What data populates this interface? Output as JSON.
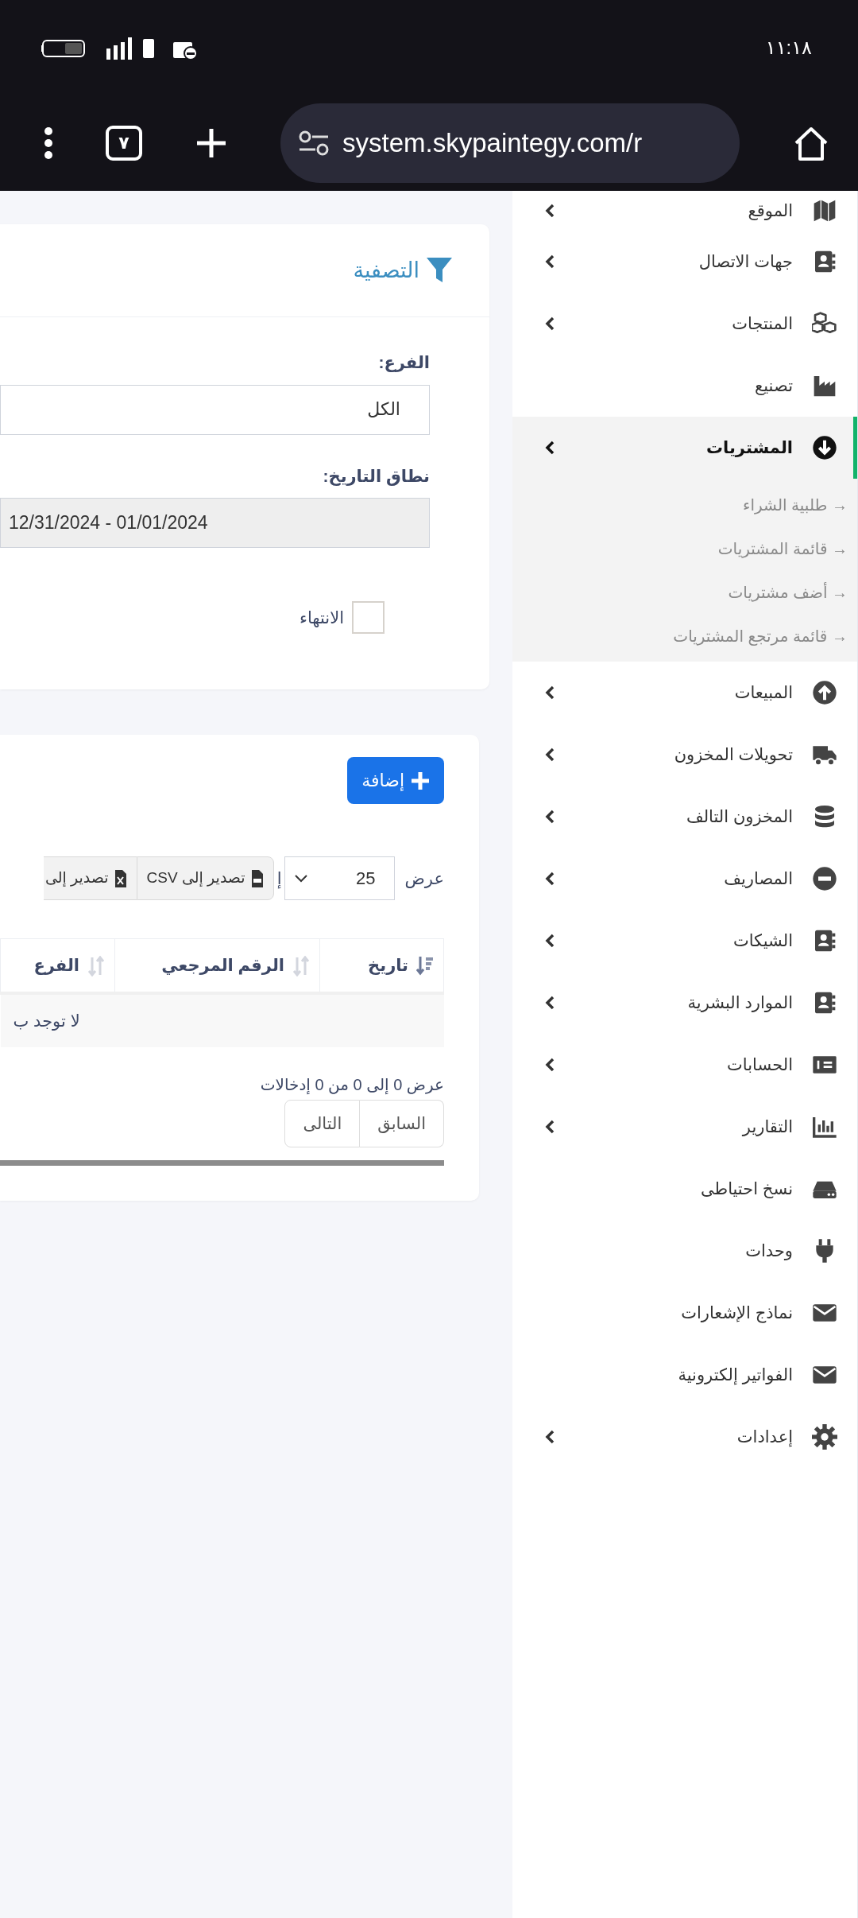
{
  "status_bar": {
    "time": "١١:١٨"
  },
  "browser": {
    "tab_count": "٧",
    "url": "system.skypaintegy.com/r"
  },
  "sidebar": {
    "items": [
      {
        "label": "الموقع",
        "has_submenu": true,
        "selected": false
      },
      {
        "label": "جهات الاتصال",
        "has_submenu": true,
        "selected": false
      },
      {
        "label": "المنتجات",
        "has_submenu": true,
        "selected": false
      },
      {
        "label": "تصنيع",
        "has_submenu": false,
        "selected": false
      },
      {
        "label": "المشتريات",
        "has_submenu": true,
        "selected": true,
        "children": [
          {
            "label": "→ طلبية الشراء"
          },
          {
            "label": "→ قائمة المشتريات"
          },
          {
            "label": "→ أضف مشتريات"
          },
          {
            "label": "→ قائمة مرتجع المشتريات"
          }
        ]
      },
      {
        "label": "المبيعات",
        "has_submenu": true,
        "selected": false
      },
      {
        "label": "تحويلات المخزون",
        "has_submenu": true,
        "selected": false
      },
      {
        "label": "المخزون التالف",
        "has_submenu": true,
        "selected": false
      },
      {
        "label": "المصاريف",
        "has_submenu": true,
        "selected": false
      },
      {
        "label": "الشيكات",
        "has_submenu": true,
        "selected": false
      },
      {
        "label": "الموارد البشرية",
        "has_submenu": true,
        "selected": false
      },
      {
        "label": "الحسابات",
        "has_submenu": true,
        "selected": false
      },
      {
        "label": "التقارير",
        "has_submenu": true,
        "selected": false
      },
      {
        "label": "نسخ احتياطى",
        "has_submenu": false,
        "selected": false
      },
      {
        "label": "وحدات",
        "has_submenu": false,
        "selected": false
      },
      {
        "label": "نماذج الإشعارات",
        "has_submenu": false,
        "selected": false
      },
      {
        "label": "الفواتير إلكترونية",
        "has_submenu": false,
        "selected": false
      },
      {
        "label": "إعدادات",
        "has_submenu": true,
        "selected": false
      }
    ]
  },
  "filter": {
    "title": "التصفية",
    "fields": [
      {
        "label": "الفرع:",
        "value": "الكل",
        "readonly": false
      },
      {
        "label": "نطاق التاريخ:",
        "value": "12/31/2024 - 01/01/2024",
        "readonly": true
      }
    ],
    "checkbox": {
      "label": "الانتهاء",
      "checked": false
    }
  },
  "list_panel": {
    "add_button": "إضافة",
    "length_label": "عرض",
    "length_value": "25",
    "length_suffix": "إ",
    "export_buttons": [
      "تصدير إلى CSV",
      "تصدير إلى"
    ],
    "columns": [
      {
        "label": "تاريخ",
        "sorted": true
      },
      {
        "label": "الرقم المرجعي",
        "sorted": false
      },
      {
        "label": "الفرع",
        "sorted": false
      }
    ],
    "empty_text": "لا توجد ب",
    "info": "عرض 0 إلى 0 من 0 إدخالات",
    "pagination": [
      "السابق",
      "التالى"
    ]
  }
}
